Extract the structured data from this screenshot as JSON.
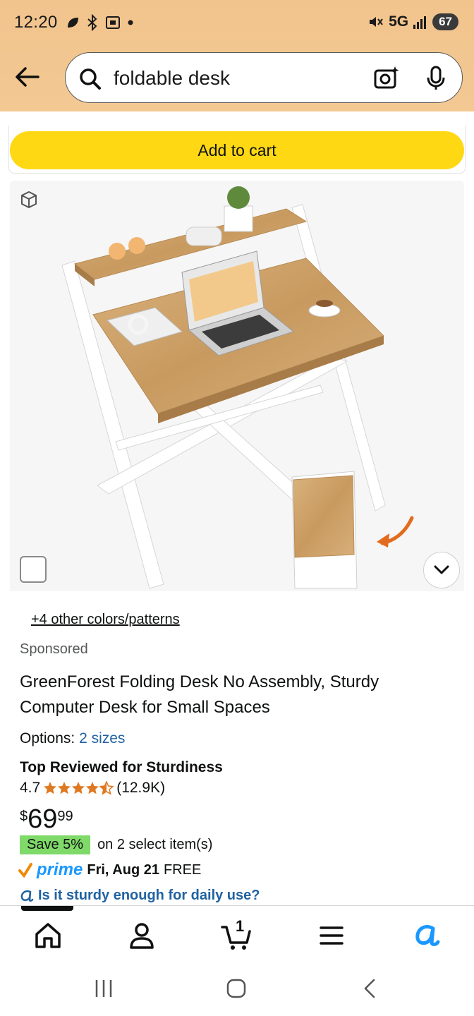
{
  "status_bar": {
    "time": "12:20",
    "network": "5G",
    "battery": "67",
    "icons": [
      "leaf-icon",
      "bluetooth-icon",
      "screenshot-icon",
      "dot-icon",
      "mute-icon",
      "signal-icon",
      "battery-icon"
    ]
  },
  "search": {
    "query": "foldable desk",
    "icons": [
      "back-arrow-icon",
      "search-icon",
      "camera-lens-icon",
      "microphone-icon"
    ]
  },
  "cart": {
    "add_label": "Add to cart"
  },
  "product": {
    "image_alt": "foldable desk product photo",
    "colors_link": "+4 other colors/patterns",
    "sponsored": "Sponsored",
    "title": "GreenForest Folding Desk No Assembly, Sturdy Computer Desk for Small Spaces",
    "options_label": "Options:",
    "options_value": "2 sizes",
    "badge": "Top Reviewed for Sturdiness",
    "rating": "4.7",
    "rating_value": 4.7,
    "reviews": "(12.9K)",
    "price_currency": "$",
    "price_whole": "69",
    "price_fraction": "99",
    "save_badge": "Save 5%",
    "save_note": "on 2 select item(s)",
    "prime": "prime",
    "delivery_date": "Fri, Aug 21",
    "delivery_cost": "FREE",
    "ask_question": "Is it sturdy enough for daily use?"
  },
  "bottom_nav": {
    "items": [
      "home-icon",
      "account-icon",
      "cart-icon",
      "menu-icon",
      "rufus-icon"
    ],
    "cart_count": "1",
    "active_index": 0
  },
  "colors": {
    "header_bg": "#f2c48d",
    "cart_button": "#ffd814",
    "link": "#2162a1",
    "save_badge": "#7fda69",
    "prime_blue": "#1a98ff",
    "star": "#de7921"
  }
}
